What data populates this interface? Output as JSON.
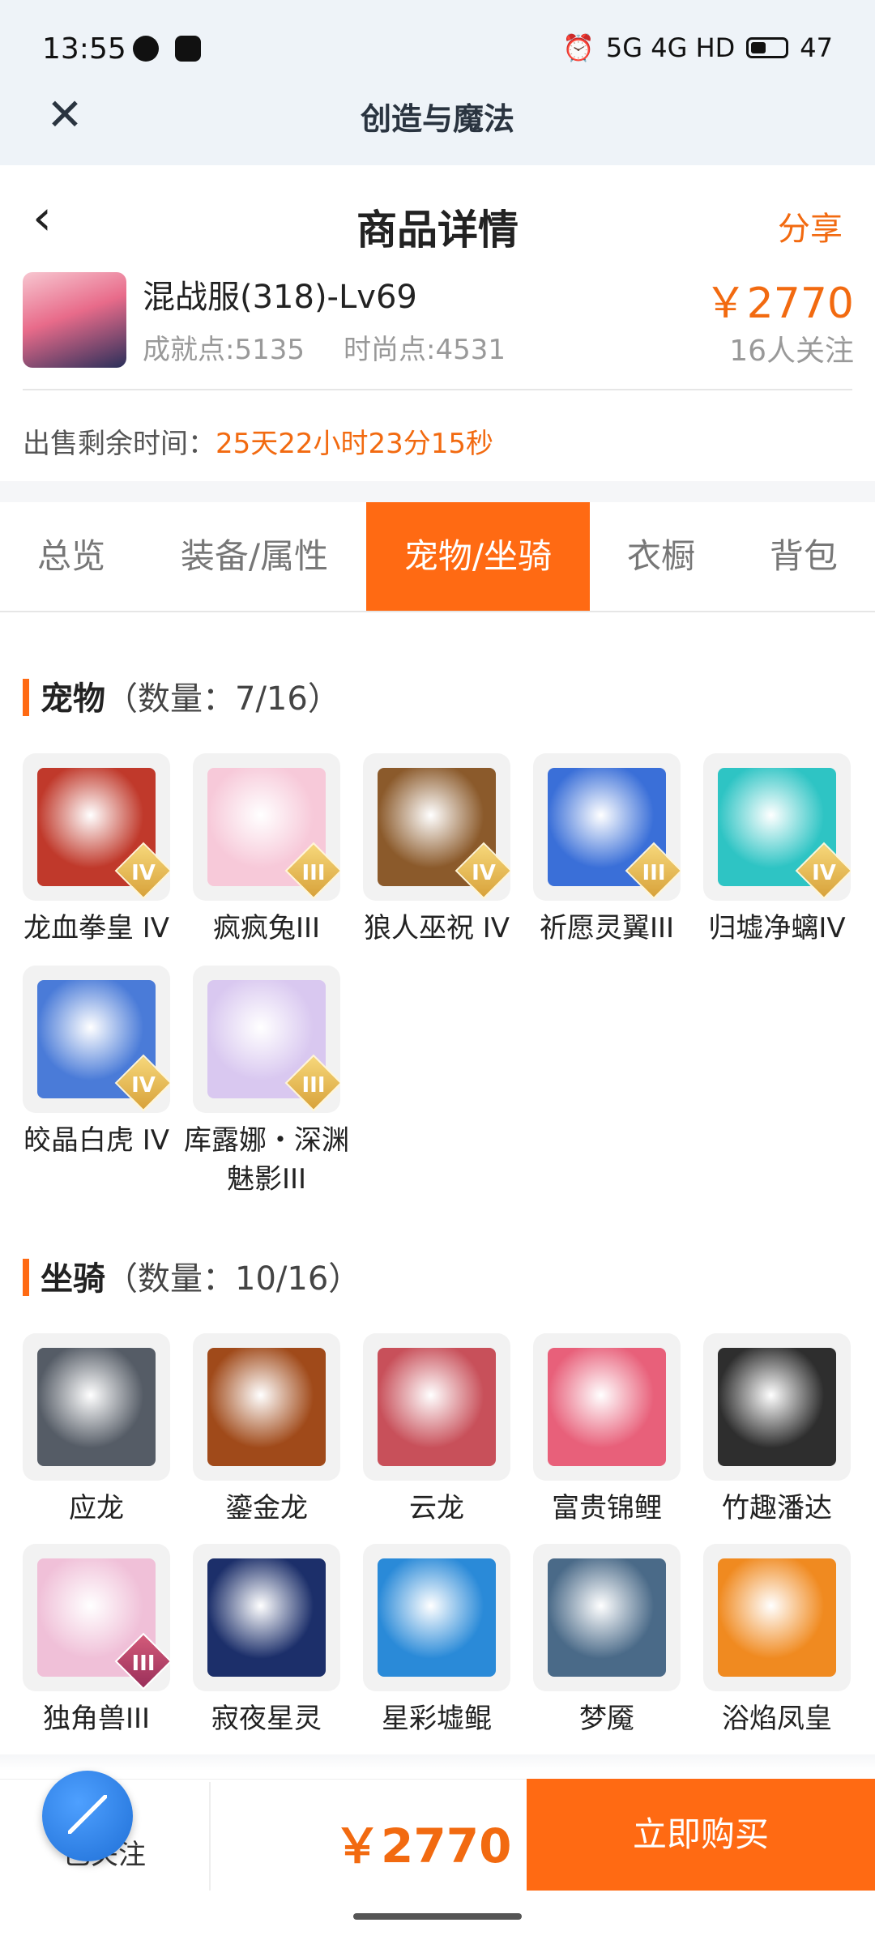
{
  "status": {
    "time": "13:55",
    "network": "5G 4G HD",
    "battery": "47"
  },
  "app": {
    "title": "创造与魔法"
  },
  "nav": {
    "title": "商品详情",
    "share": "分享"
  },
  "product": {
    "name": "混战服(318)-Lv69",
    "achievement": "成就点:5135",
    "fashion": "时尚点:4531",
    "price": "￥2770",
    "followers": "16人关注",
    "remain_label": "出售剩余时间：",
    "remain_value": "25天22小时23分15秒"
  },
  "tabs": [
    {
      "label": "总览",
      "active": false
    },
    {
      "label": "装备/属性",
      "active": false
    },
    {
      "label": "宠物/坐骑",
      "active": true
    },
    {
      "label": "衣橱",
      "active": false
    },
    {
      "label": "背包",
      "active": false
    }
  ],
  "pets": {
    "title": "宠物",
    "count": "（数量：7/16）",
    "items": [
      {
        "name": "龙血拳皇 IV",
        "tier": "IV",
        "color": "#c0392b"
      },
      {
        "name": "疯疯兔III",
        "tier": "III",
        "color": "#f7c9d9"
      },
      {
        "name": "狼人巫祝 IV",
        "tier": "IV",
        "color": "#8b5a2b"
      },
      {
        "name": "祈愿灵翼III",
        "tier": "III",
        "color": "#3a6fd8"
      },
      {
        "name": "归墟净螭IV",
        "tier": "IV",
        "color": "#2ec4c4"
      },
      {
        "name": "皎晶白虎 IV",
        "tier": "IV",
        "color": "#4a7bd8"
      },
      {
        "name": "库露娜・深渊魅影III",
        "tier": "III",
        "color": "#d9c8f0"
      }
    ]
  },
  "mounts": {
    "title": "坐骑",
    "count": "（数量：10/16）",
    "items": [
      {
        "name": "应龙",
        "tier": "",
        "color": "#555c66"
      },
      {
        "name": "鎏金龙",
        "tier": "",
        "color": "#a04a1a"
      },
      {
        "name": "云龙",
        "tier": "",
        "color": "#c8505a"
      },
      {
        "name": "富贵锦鲤",
        "tier": "",
        "color": "#e8607a"
      },
      {
        "name": "竹趣潘达",
        "tier": "",
        "color": "#2e2e2e"
      },
      {
        "name": "独角兽III",
        "tier": "III",
        "color": "#f0c0d8"
      },
      {
        "name": "寂夜星灵",
        "tier": "",
        "color": "#1c2f6a"
      },
      {
        "name": "星彩墟鲲",
        "tier": "",
        "color": "#2a8ad8"
      },
      {
        "name": "梦魇",
        "tier": "",
        "color": "#4a6a88"
      },
      {
        "name": "浴焰凤皇",
        "tier": "",
        "color": "#f08a20"
      }
    ]
  },
  "bottom": {
    "followed": "已关注",
    "price": "￥2770",
    "buy": "立即购买"
  },
  "colors": {
    "accent": "#ff6a13",
    "price": "#f26a10"
  }
}
